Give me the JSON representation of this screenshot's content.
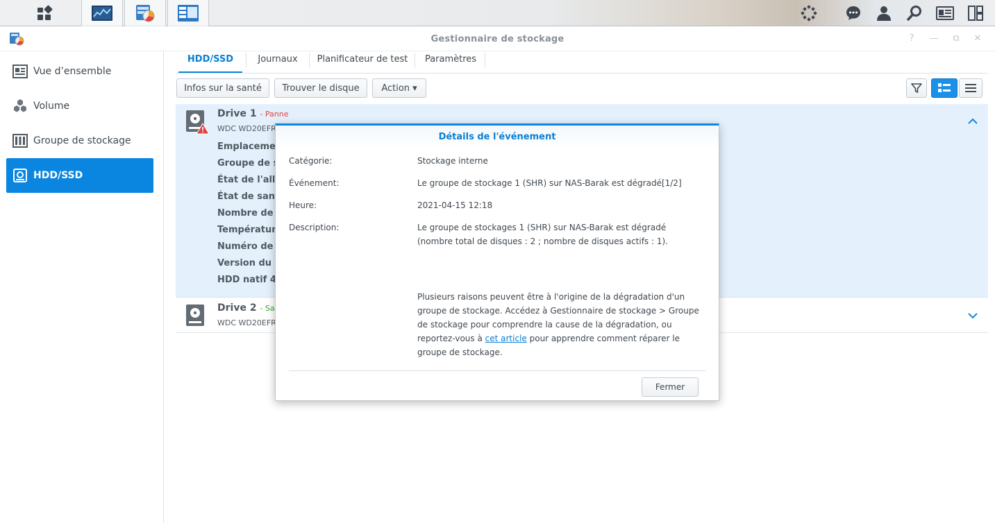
{
  "window": {
    "title": "Gestionnaire de stockage",
    "controls": [
      "?",
      "—",
      "⧉",
      "✕"
    ]
  },
  "sidebar": {
    "items": [
      {
        "label": "Vue d’ensemble",
        "icon": "overview-icon"
      },
      {
        "label": "Volume",
        "icon": "volume-icon"
      },
      {
        "label": "Groupe de stockage",
        "icon": "storage-pool-icon"
      },
      {
        "label": "HDD/SSD",
        "icon": "hdd-icon",
        "active": true
      }
    ]
  },
  "tabs": [
    {
      "label": "HDD/SSD",
      "active": true
    },
    {
      "label": "Journaux"
    },
    {
      "label": "Planificateur de test"
    },
    {
      "label": "Paramètres"
    }
  ],
  "toolbar": {
    "health_label": "Infos sur la santé",
    "locate_label": "Trouver le disque",
    "action_label": "Action ▾"
  },
  "drives": [
    {
      "name": "Drive 1",
      "status": "- Panne",
      "status_color": "#e04343",
      "model": "WDC WD20EFR",
      "fields": [
        "Emplacement",
        "Groupe de st",
        "État de l'allo",
        "État de santé",
        "Nombre de s",
        "Température",
        "Numéro de s",
        "Version du fi",
        "HDD natif 4K"
      ]
    },
    {
      "name": "Drive 2",
      "status": "- Sa",
      "status_color": "#3aa53a",
      "model": "WDC WD20EFR"
    }
  ],
  "dialog": {
    "title": "Détails de l'événement",
    "category_label": "Catégorie:",
    "category_value": "Stockage interne",
    "event_label": "Événement:",
    "event_value": "Le groupe de stockage 1 (SHR) sur NAS-Barak est dégradé[1/2]",
    "time_label": "Heure:",
    "time_value": "2021-04-15 12:18",
    "description_label": "Description:",
    "description_value": "Le groupe de stockages 1 (SHR) sur NAS-Barak est dégradé (nombre total de disques : 2 ; nombre de disques actifs : 1).",
    "info_text_1": "Plusieurs raisons peuvent être à l'origine de la dégradation d'un groupe de stockage. Accédez à Gestionnaire de stockage > Groupe de stockage pour comprendre la cause de la dégradation, ou reportez-vous à",
    "info_link": "cet article",
    "info_text_2": "pour apprendre comment réparer le groupe de stockage.",
    "close_label": "Fermer"
  },
  "colors": {
    "accent": "#0a86e0",
    "selected_row": "#e4f1fc",
    "danger": "#e04343"
  }
}
